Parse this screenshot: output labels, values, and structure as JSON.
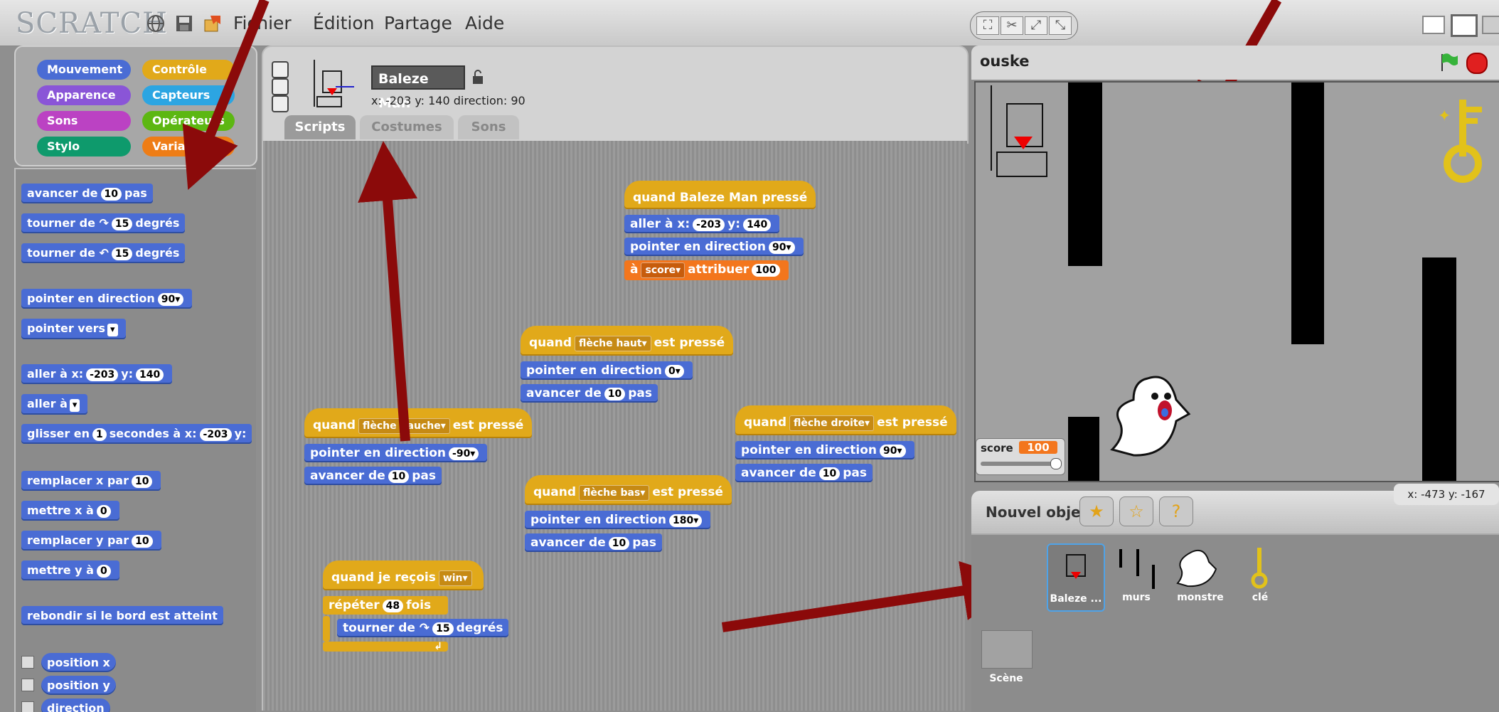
{
  "topbar": {
    "logo": "SCRATCH",
    "menus": [
      "Fichier",
      "Édition",
      "Partage",
      "Aide"
    ]
  },
  "palette": {
    "categories": [
      {
        "label": "Mouvement",
        "color": "#4a6cd4"
      },
      {
        "label": "Contrôle",
        "color": "#e1a91a"
      },
      {
        "label": "Apparence",
        "color": "#8a55d7"
      },
      {
        "label": "Capteurs",
        "color": "#2ca5e2"
      },
      {
        "label": "Sons",
        "color": "#bb42c3"
      },
      {
        "label": "Opérateurs",
        "color": "#5cb712"
      },
      {
        "label": "Stylo",
        "color": "#0e9a6c"
      },
      {
        "label": "Variables",
        "color": "#ee7d16"
      }
    ],
    "blocks": {
      "move": {
        "pre": "avancer de",
        "val": "10",
        "post": "pas"
      },
      "turn_right": {
        "pre": "tourner de ↷",
        "val": "15",
        "post": "degrés"
      },
      "turn_left": {
        "pre": "tourner de ↶",
        "val": "15",
        "post": "degrés"
      },
      "point_dir": {
        "pre": "pointer en direction",
        "val": "90▾"
      },
      "point_towards": {
        "pre": "pointer vers",
        "val": "▾"
      },
      "goto_xy": {
        "pre": "aller à x:",
        "x": "-203",
        "mid": "y:",
        "y": "140"
      },
      "goto": {
        "pre": "aller à",
        "val": "▾"
      },
      "glide": {
        "pre": "glisser en",
        "secs": "1",
        "mid": "secondes à x:",
        "x": "-203",
        "post": "y:"
      },
      "change_x": {
        "pre": "remplacer x par",
        "val": "10"
      },
      "set_x": {
        "pre": "mettre x à",
        "val": "0"
      },
      "change_y": {
        "pre": "remplacer y par",
        "val": "10"
      },
      "set_y": {
        "pre": "mettre y à",
        "val": "0"
      },
      "bounce": "rebondir si le bord est atteint",
      "rep_x": "position x",
      "rep_y": "position y",
      "rep_dir": "direction"
    }
  },
  "sprite": {
    "name": "Baleze Man",
    "coords": "x: -203  y: 140   direction: 90",
    "tabs": [
      "Scripts",
      "Costumes",
      "Sons"
    ]
  },
  "scripts": {
    "s1": {
      "hat": "quand Baleze Man pressé",
      "goto_pre": "aller à x:",
      "goto_x": "-203",
      "goto_mid": "y:",
      "goto_y": "140",
      "dir_pre": "pointer en direction",
      "dir_val": "90▾",
      "var_pre": "à",
      "var_name": "score▾",
      "var_mid": "attribuer",
      "var_val": "100"
    },
    "s2": {
      "hat_pre": "quand",
      "key": "flèche haut▾",
      "hat_post": "est pressé",
      "dir_pre": "pointer en direction",
      "dir_val": "0▾",
      "move_pre": "avancer de",
      "move_val": "10",
      "move_post": "pas"
    },
    "s3": {
      "hat_pre": "quand",
      "key": "flèche gauche▾",
      "hat_post": "est pressé",
      "dir_pre": "pointer en direction",
      "dir_val": "-90▾",
      "move_pre": "avancer de",
      "move_val": "10",
      "move_post": "pas"
    },
    "s4": {
      "hat_pre": "quand",
      "key": "flèche droite▾",
      "hat_post": "est pressé",
      "dir_pre": "pointer en direction",
      "dir_val": "90▾",
      "move_pre": "avancer de",
      "move_val": "10",
      "move_post": "pas"
    },
    "s5": {
      "hat_pre": "quand",
      "key": "flèche bas▾",
      "hat_post": "est pressé",
      "dir_pre": "pointer en direction",
      "dir_val": "180▾",
      "move_pre": "avancer de",
      "move_val": "10",
      "move_post": "pas"
    },
    "s6": {
      "hat_pre": "quand je reçois",
      "msg": "win▾",
      "rep_pre": "répéter",
      "rep_val": "48",
      "rep_post": "fois",
      "turn_pre": "tourner de ↷",
      "turn_val": "15",
      "turn_post": "degrés"
    }
  },
  "stage": {
    "title": "ouske",
    "score_label": "score",
    "score_value": "100"
  },
  "objects": {
    "new_label": "Nouvel objet",
    "mouse": "x: -473   y: -167",
    "sprites": [
      "Baleze ...",
      "murs",
      "monstre",
      "clé"
    ],
    "stage_label": "Scène"
  }
}
